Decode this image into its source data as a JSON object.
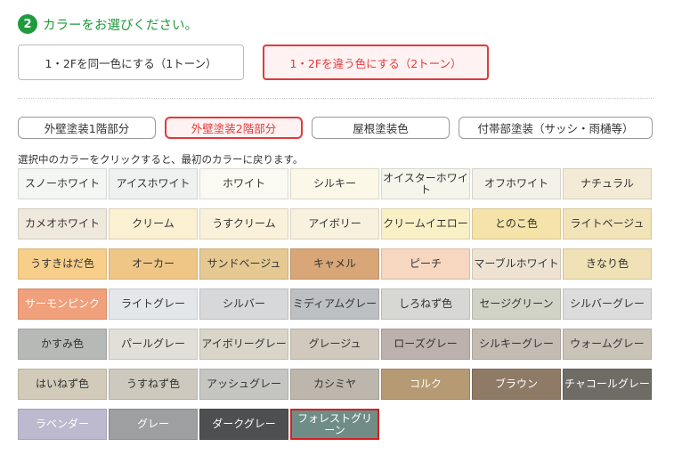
{
  "step": {
    "number": "2",
    "title": "カラーをお選びください。"
  },
  "tone_buttons": [
    {
      "label": "1・2Fを同一色にする（1トーン）",
      "active": false
    },
    {
      "label": "1・2Fを違う色にする（2トーン）",
      "active": true
    }
  ],
  "part_buttons": [
    {
      "label": "外壁塗装1階部分",
      "active": false
    },
    {
      "label": "外壁塗装2階部分",
      "active": true
    },
    {
      "label": "屋根塗装色",
      "active": false
    },
    {
      "label": "付帯部塗装（サッシ・雨樋等）",
      "active": false
    }
  ],
  "instruction": "選択中のカラーをクリックすると、最初のカラーに戻ります。",
  "colors": {
    "accent_green": "#1f9a3c",
    "active_red": "#e03b3b",
    "selected_border": "#d42020"
  },
  "swatches": [
    {
      "label": "スノーホワイト",
      "color": "#f4f6f4",
      "text": "#333333"
    },
    {
      "label": "アイスホワイト",
      "color": "#eef1f0",
      "text": "#333333"
    },
    {
      "label": "ホワイト",
      "color": "#fbfaf2",
      "text": "#333333"
    },
    {
      "label": "シルキー",
      "color": "#fbf8e8",
      "text": "#333333"
    },
    {
      "label": "オイスターホワイト",
      "color": "#f5f5ec",
      "text": "#333333"
    },
    {
      "label": "オフホワイト",
      "color": "#f3f1e8",
      "text": "#333333"
    },
    {
      "label": "ナチュラル",
      "color": "#f4ebd6",
      "text": "#333333"
    },
    {
      "label": "カメオホワイト",
      "color": "#efe8dc",
      "text": "#333333"
    },
    {
      "label": "クリーム",
      "color": "#fbf0d2",
      "text": "#333333"
    },
    {
      "label": "うすクリーム",
      "color": "#faf1da",
      "text": "#333333"
    },
    {
      "label": "アイボリー",
      "color": "#f7f1de",
      "text": "#333333"
    },
    {
      "label": "クリームイエロー",
      "color": "#f9f0c6",
      "text": "#333333"
    },
    {
      "label": "とのこ色",
      "color": "#f6e3a9",
      "text": "#333333"
    },
    {
      "label": "ライトベージュ",
      "color": "#f3e3b8",
      "text": "#333333"
    },
    {
      "label": "うすきはだ色",
      "color": "#f7cf8a",
      "text": "#333333"
    },
    {
      "label": "オーカー",
      "color": "#f0c687",
      "text": "#333333"
    },
    {
      "label": "サンドベージュ",
      "color": "#e5c892",
      "text": "#333333"
    },
    {
      "label": "キャメル",
      "color": "#d8a677",
      "text": "#333333"
    },
    {
      "label": "ピーチ",
      "color": "#f8d7c1",
      "text": "#333333"
    },
    {
      "label": "マーブルホワイト",
      "color": "#eee3d2",
      "text": "#333333"
    },
    {
      "label": "きなり色",
      "color": "#f0e1b6",
      "text": "#333333"
    },
    {
      "label": "サーモンピンク",
      "color": "#f0a07a",
      "text": "#ffffff"
    },
    {
      "label": "ライトグレー",
      "color": "#e4e7ea",
      "text": "#333333"
    },
    {
      "label": "シルバー",
      "color": "#d6d8da",
      "text": "#333333"
    },
    {
      "label": "ミディアムグレー",
      "color": "#bdc0c2",
      "text": "#333333"
    },
    {
      "label": "しろねず色",
      "color": "#d7d8d4",
      "text": "#333333"
    },
    {
      "label": "セージグリーン",
      "color": "#d0d3c5",
      "text": "#333333"
    },
    {
      "label": "シルバーグレー",
      "color": "#dcdcdc",
      "text": "#333333"
    },
    {
      "label": "かすみ色",
      "color": "#b7b9b6",
      "text": "#333333"
    },
    {
      "label": "パールグレー",
      "color": "#e2dfd8",
      "text": "#333333"
    },
    {
      "label": "アイボリーグレー",
      "color": "#d9d5c9",
      "text": "#333333"
    },
    {
      "label": "グレージュ",
      "color": "#d1c9bd",
      "text": "#333333"
    },
    {
      "label": "ローズグレー",
      "color": "#bdb1ad",
      "text": "#333333"
    },
    {
      "label": "シルキーグレー",
      "color": "#c4bbb2",
      "text": "#333333"
    },
    {
      "label": "ウォームグレー",
      "color": "#cac3b8",
      "text": "#333333"
    },
    {
      "label": "はいねず色",
      "color": "#d2cbba",
      "text": "#333333"
    },
    {
      "label": "うすねず色",
      "color": "#cdc9bf",
      "text": "#333333"
    },
    {
      "label": "アッシュグレー",
      "color": "#c5c6c2",
      "text": "#333333"
    },
    {
      "label": "カシミヤ",
      "color": "#bdb6ac",
      "text": "#333333"
    },
    {
      "label": "コルク",
      "color": "#b69a73",
      "text": "#ffffff"
    },
    {
      "label": "ブラウン",
      "color": "#8f7a66",
      "text": "#ffffff"
    },
    {
      "label": "チャコールグレー",
      "color": "#6f6c66",
      "text": "#ffffff"
    },
    {
      "label": "ラベンダー",
      "color": "#bdb9cf",
      "text": "#ffffff"
    },
    {
      "label": "グレー",
      "color": "#9d9fa0",
      "text": "#ffffff"
    },
    {
      "label": "ダークグレー",
      "color": "#4d4f50",
      "text": "#ffffff"
    },
    {
      "label": "フォレストグリーン",
      "color": "#6f8d86",
      "text": "#ffffff",
      "selected": true
    }
  ]
}
